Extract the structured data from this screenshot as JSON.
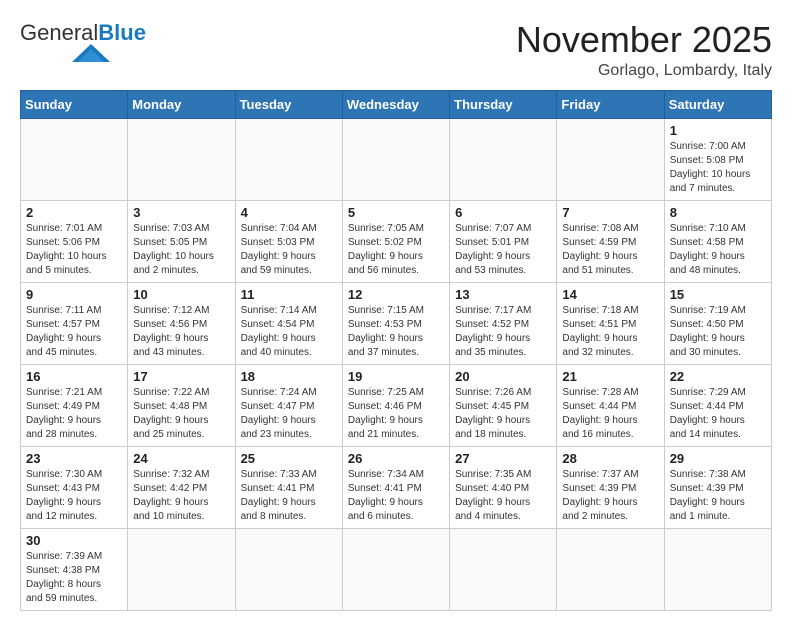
{
  "header": {
    "logo_general": "General",
    "logo_blue": "Blue",
    "month": "November 2025",
    "location": "Gorlago, Lombardy, Italy"
  },
  "days_of_week": [
    "Sunday",
    "Monday",
    "Tuesday",
    "Wednesday",
    "Thursday",
    "Friday",
    "Saturday"
  ],
  "weeks": [
    {
      "days": [
        {
          "num": "",
          "info": ""
        },
        {
          "num": "",
          "info": ""
        },
        {
          "num": "",
          "info": ""
        },
        {
          "num": "",
          "info": ""
        },
        {
          "num": "",
          "info": ""
        },
        {
          "num": "",
          "info": ""
        },
        {
          "num": "1",
          "info": "Sunrise: 7:00 AM\nSunset: 5:08 PM\nDaylight: 10 hours\nand 7 minutes."
        }
      ]
    },
    {
      "days": [
        {
          "num": "2",
          "info": "Sunrise: 7:01 AM\nSunset: 5:06 PM\nDaylight: 10 hours\nand 5 minutes."
        },
        {
          "num": "3",
          "info": "Sunrise: 7:03 AM\nSunset: 5:05 PM\nDaylight: 10 hours\nand 2 minutes."
        },
        {
          "num": "4",
          "info": "Sunrise: 7:04 AM\nSunset: 5:03 PM\nDaylight: 9 hours\nand 59 minutes."
        },
        {
          "num": "5",
          "info": "Sunrise: 7:05 AM\nSunset: 5:02 PM\nDaylight: 9 hours\nand 56 minutes."
        },
        {
          "num": "6",
          "info": "Sunrise: 7:07 AM\nSunset: 5:01 PM\nDaylight: 9 hours\nand 53 minutes."
        },
        {
          "num": "7",
          "info": "Sunrise: 7:08 AM\nSunset: 4:59 PM\nDaylight: 9 hours\nand 51 minutes."
        },
        {
          "num": "8",
          "info": "Sunrise: 7:10 AM\nSunset: 4:58 PM\nDaylight: 9 hours\nand 48 minutes."
        }
      ]
    },
    {
      "days": [
        {
          "num": "9",
          "info": "Sunrise: 7:11 AM\nSunset: 4:57 PM\nDaylight: 9 hours\nand 45 minutes."
        },
        {
          "num": "10",
          "info": "Sunrise: 7:12 AM\nSunset: 4:56 PM\nDaylight: 9 hours\nand 43 minutes."
        },
        {
          "num": "11",
          "info": "Sunrise: 7:14 AM\nSunset: 4:54 PM\nDaylight: 9 hours\nand 40 minutes."
        },
        {
          "num": "12",
          "info": "Sunrise: 7:15 AM\nSunset: 4:53 PM\nDaylight: 9 hours\nand 37 minutes."
        },
        {
          "num": "13",
          "info": "Sunrise: 7:17 AM\nSunset: 4:52 PM\nDaylight: 9 hours\nand 35 minutes."
        },
        {
          "num": "14",
          "info": "Sunrise: 7:18 AM\nSunset: 4:51 PM\nDaylight: 9 hours\nand 32 minutes."
        },
        {
          "num": "15",
          "info": "Sunrise: 7:19 AM\nSunset: 4:50 PM\nDaylight: 9 hours\nand 30 minutes."
        }
      ]
    },
    {
      "days": [
        {
          "num": "16",
          "info": "Sunrise: 7:21 AM\nSunset: 4:49 PM\nDaylight: 9 hours\nand 28 minutes."
        },
        {
          "num": "17",
          "info": "Sunrise: 7:22 AM\nSunset: 4:48 PM\nDaylight: 9 hours\nand 25 minutes."
        },
        {
          "num": "18",
          "info": "Sunrise: 7:24 AM\nSunset: 4:47 PM\nDaylight: 9 hours\nand 23 minutes."
        },
        {
          "num": "19",
          "info": "Sunrise: 7:25 AM\nSunset: 4:46 PM\nDaylight: 9 hours\nand 21 minutes."
        },
        {
          "num": "20",
          "info": "Sunrise: 7:26 AM\nSunset: 4:45 PM\nDaylight: 9 hours\nand 18 minutes."
        },
        {
          "num": "21",
          "info": "Sunrise: 7:28 AM\nSunset: 4:44 PM\nDaylight: 9 hours\nand 16 minutes."
        },
        {
          "num": "22",
          "info": "Sunrise: 7:29 AM\nSunset: 4:44 PM\nDaylight: 9 hours\nand 14 minutes."
        }
      ]
    },
    {
      "days": [
        {
          "num": "23",
          "info": "Sunrise: 7:30 AM\nSunset: 4:43 PM\nDaylight: 9 hours\nand 12 minutes."
        },
        {
          "num": "24",
          "info": "Sunrise: 7:32 AM\nSunset: 4:42 PM\nDaylight: 9 hours\nand 10 minutes."
        },
        {
          "num": "25",
          "info": "Sunrise: 7:33 AM\nSunset: 4:41 PM\nDaylight: 9 hours\nand 8 minutes."
        },
        {
          "num": "26",
          "info": "Sunrise: 7:34 AM\nSunset: 4:41 PM\nDaylight: 9 hours\nand 6 minutes."
        },
        {
          "num": "27",
          "info": "Sunrise: 7:35 AM\nSunset: 4:40 PM\nDaylight: 9 hours\nand 4 minutes."
        },
        {
          "num": "28",
          "info": "Sunrise: 7:37 AM\nSunset: 4:39 PM\nDaylight: 9 hours\nand 2 minutes."
        },
        {
          "num": "29",
          "info": "Sunrise: 7:38 AM\nSunset: 4:39 PM\nDaylight: 9 hours\nand 1 minute."
        }
      ]
    },
    {
      "days": [
        {
          "num": "30",
          "info": "Sunrise: 7:39 AM\nSunset: 4:38 PM\nDaylight: 8 hours\nand 59 minutes."
        },
        {
          "num": "",
          "info": ""
        },
        {
          "num": "",
          "info": ""
        },
        {
          "num": "",
          "info": ""
        },
        {
          "num": "",
          "info": ""
        },
        {
          "num": "",
          "info": ""
        },
        {
          "num": "",
          "info": ""
        }
      ]
    }
  ]
}
